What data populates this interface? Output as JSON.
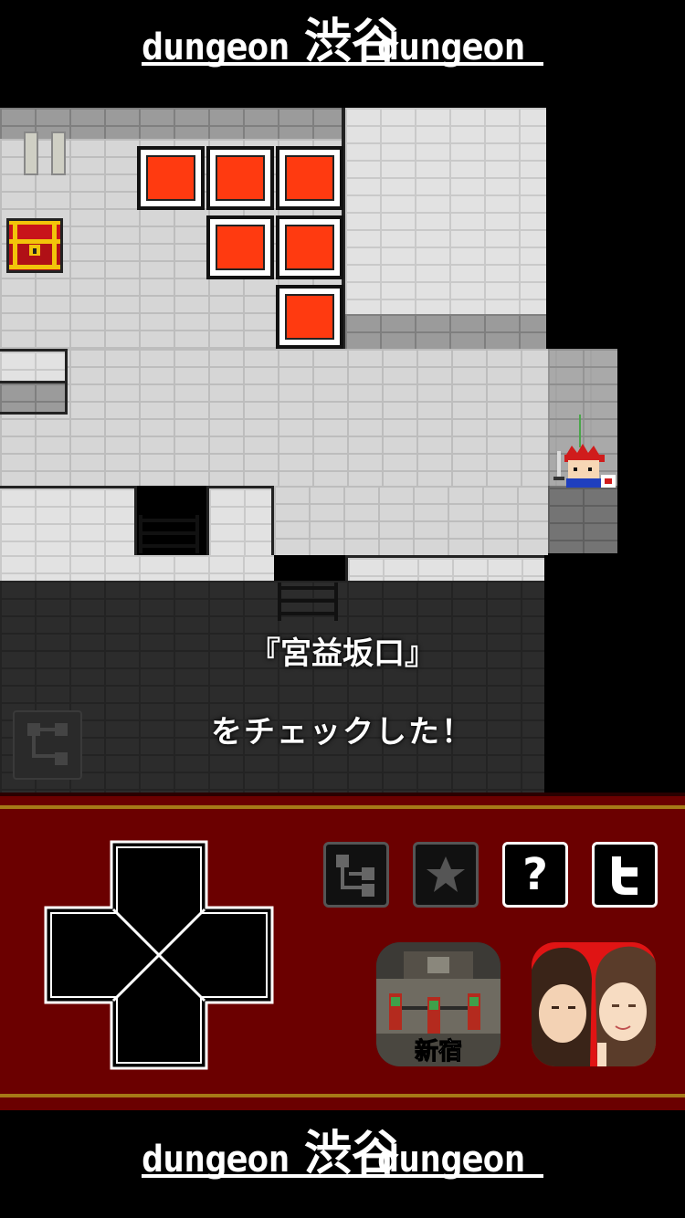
{
  "header_logo": {
    "left_word": "dungeon",
    "kanji": "渋谷",
    "right_word": "dungeon"
  },
  "footer_logo": {
    "left_word": "dungeon",
    "kanji": "渋谷",
    "right_word": "dungeon"
  },
  "message": {
    "line1": "『宮益坂口』",
    "line2": "をチェックした！"
  },
  "toolbar": {
    "map_icon": "map-icon",
    "favorite_icon": "star-icon",
    "help_label": "?",
    "twitter_icon": "twitter-icon"
  },
  "promo_apps": [
    {
      "name": "shinjuku-dungeon-app",
      "caption": "新宿"
    },
    {
      "name": "manga-app",
      "caption": ""
    }
  ],
  "colors": {
    "panel_red": "#6b0000",
    "gold_line": "#a67a17",
    "block_red": "#ff3a10"
  }
}
